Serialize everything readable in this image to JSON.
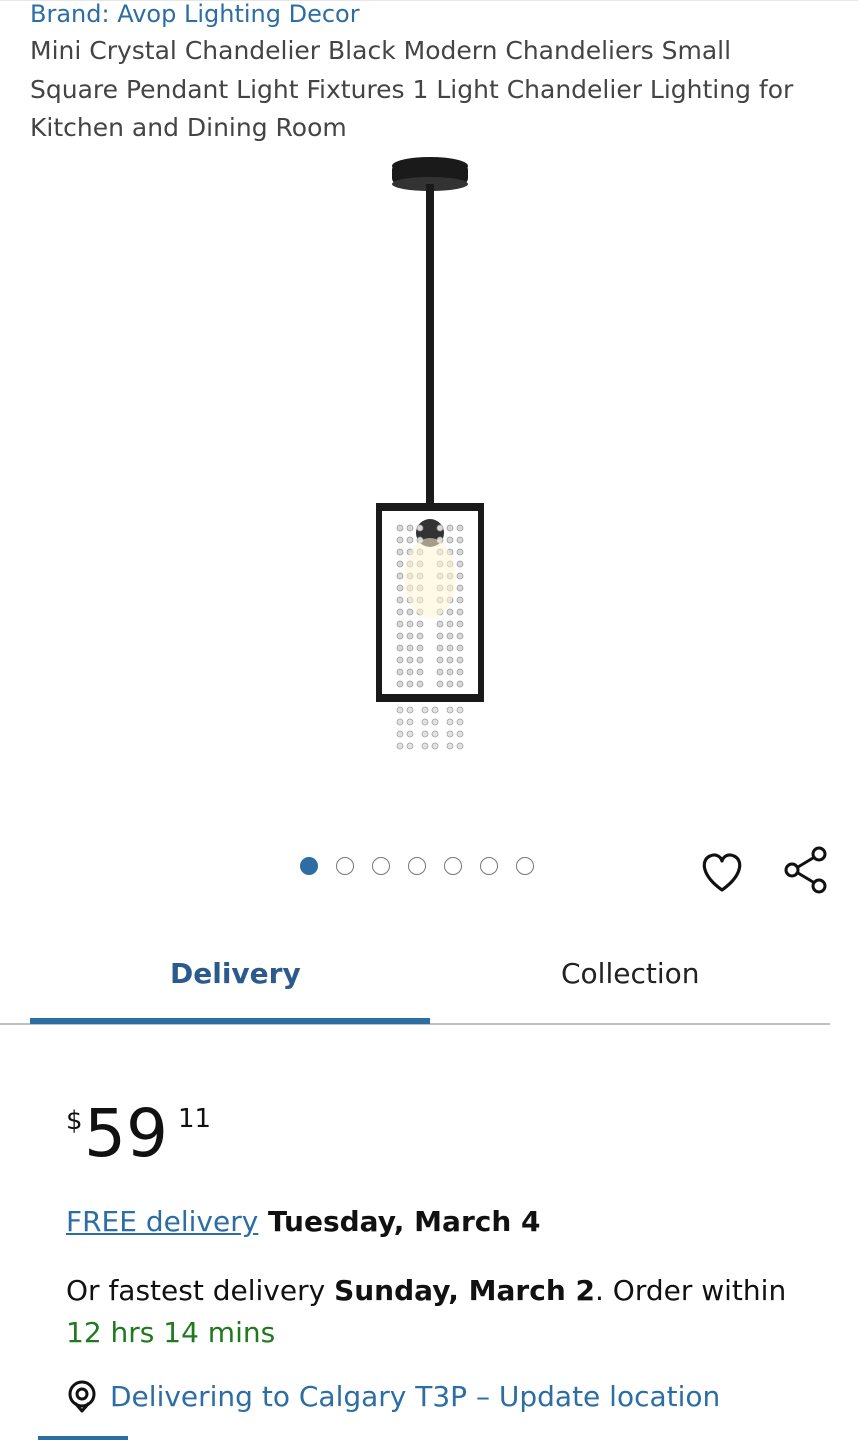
{
  "product": {
    "brand": "Brand: Avop Lighting Decor",
    "title": "Mini Crystal Chandelier Black Modern Chandeliers Small Square Pendant Light Fixtures 1 Light Chandelier Lighting for Kitchen and Dining Room"
  },
  "carousel": {
    "total_images": 7,
    "active_index": 0
  },
  "icons": {
    "wishlist": "heart-icon",
    "share": "share-icon",
    "location": "location-pin-icon"
  },
  "tabs": [
    {
      "label": "Delivery",
      "active": true
    },
    {
      "label": "Collection",
      "active": false
    }
  ],
  "price": {
    "currency_symbol": "$",
    "whole": "59",
    "fraction": "11"
  },
  "delivery": {
    "free_label": "FREE delivery",
    "free_date": " Tuesday, March 4",
    "fastest_prefix": "Or fastest delivery ",
    "fastest_date": "Sunday, March 2",
    "order_within_text": ". Order within",
    "countdown": "12 hrs 14 mins",
    "location_text": "Delivering to Calgary T3P – Update location"
  },
  "colors": {
    "accent": "#2c6ea3",
    "green": "#1f7a1f",
    "text": "#111111"
  }
}
